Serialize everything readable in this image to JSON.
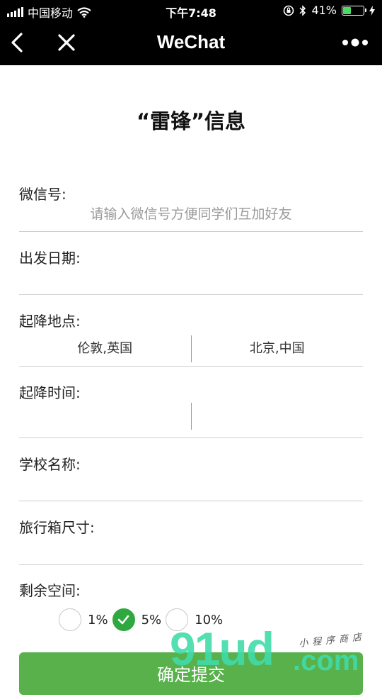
{
  "status_bar": {
    "carrier": "中国移动",
    "time": "下午7:48",
    "battery_percent": "41%",
    "battery_level": 0.41,
    "battery_color": "#4cd964"
  },
  "nav": {
    "title": "WeChat",
    "back_icon": "chevron-left-icon",
    "close_icon": "close-icon",
    "more_icon": "more-dots-icon"
  },
  "page": {
    "title": "“雷锋”信息"
  },
  "form": {
    "wechat_id": {
      "label": "微信号:",
      "value": "",
      "placeholder": "请输入微信号方便同学们互加好友"
    },
    "departure_date": {
      "label": "出发日期:",
      "value": ""
    },
    "route": {
      "label": "起降地点:",
      "from": "伦敦,英国",
      "to": "北京,中国"
    },
    "times": {
      "label": "起降时间:",
      "departure": "",
      "arrival": ""
    },
    "school": {
      "label": "学校名称:",
      "value": ""
    },
    "luggage_size": {
      "label": "旅行箱尺寸:",
      "value": ""
    },
    "remaining_space": {
      "label": "剩余空间:",
      "options": [
        {
          "label": "1%",
          "checked": false
        },
        {
          "label": "5%",
          "checked": true
        },
        {
          "label": "10%",
          "checked": false
        }
      ]
    }
  },
  "submit": {
    "label": "确定提交"
  },
  "colors": {
    "accent": "#2ea83f",
    "button": "#58b14b",
    "header": "#000000"
  },
  "watermark": {
    "big": "91ud",
    "com": ".com",
    "small": "小程序商店"
  }
}
